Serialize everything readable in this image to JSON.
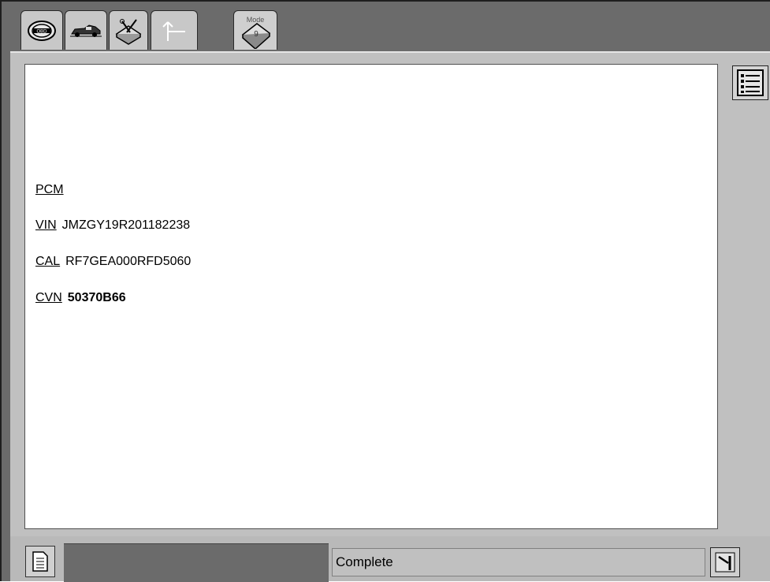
{
  "toolbar": {
    "tabs": [
      {
        "name": "obd-logo-icon"
      },
      {
        "name": "vehicle-icon"
      },
      {
        "name": "toolbox-icon"
      },
      {
        "name": "back-arrow-icon"
      },
      {
        "name": "mode-9-icon",
        "label": "Mode",
        "number": "9"
      }
    ]
  },
  "content": {
    "module": "PCM",
    "rows": [
      {
        "label": "VIN",
        "value": "JMZGY19R201182238"
      },
      {
        "label": "CAL",
        "value": "RF7GEA000RFD5060"
      },
      {
        "label": "CVN",
        "value": "50370B66"
      }
    ]
  },
  "status": {
    "text": "Complete"
  }
}
